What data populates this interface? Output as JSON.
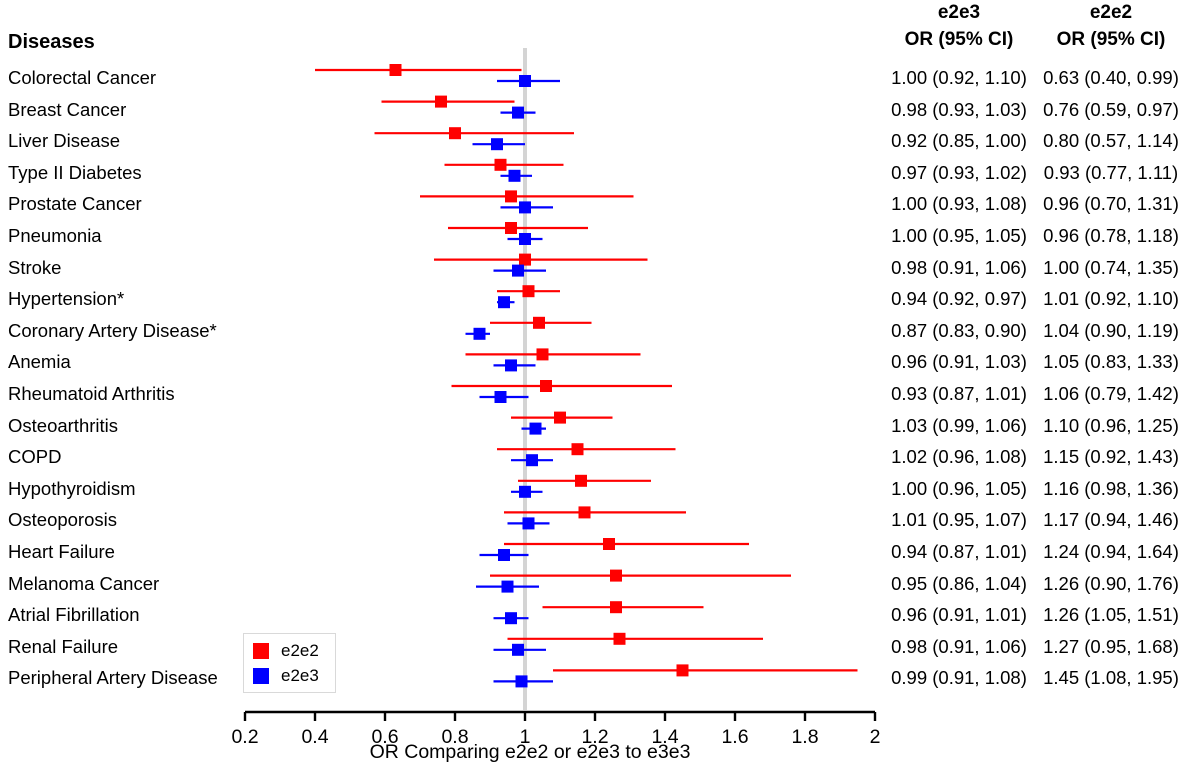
{
  "header": {
    "diseases_label": "Diseases",
    "col1_title": "e2e3",
    "col1_sub": "OR (95% CI)",
    "col2_title": "e2e2",
    "col2_sub": "OR (95% CI)"
  },
  "legend": {
    "items": [
      {
        "label": "e2e2",
        "color": "#FF0000",
        "name": "legend-e2e2"
      },
      {
        "label": "e2e3",
        "color": "#0000FF",
        "name": "legend-e2e3"
      }
    ]
  },
  "axis": {
    "title": "OR Comparing e2e2 or e2e3 to e3e3",
    "ticks": [
      "0.2",
      "0.4",
      "0.6",
      "0.8",
      "1",
      "1.2",
      "1.4",
      "1.6",
      "1.8",
      "2"
    ],
    "tick_values": [
      0.2,
      0.4,
      0.6,
      0.8,
      1.0,
      1.2,
      1.4,
      1.6,
      1.8,
      2.0
    ],
    "reference_line": 1.0
  },
  "chart_data": {
    "type": "forest",
    "title": "",
    "xlabel": "OR Comparing e2e2 or e2e3 to e3e3",
    "ylabel": "Diseases",
    "xlim": [
      0.2,
      2.0
    ],
    "grid": false,
    "reference_line": 1.0,
    "legend_position": "bottom-left",
    "series": [
      {
        "name": "e2e2",
        "color": "#FF0000"
      },
      {
        "name": "e2e3",
        "color": "#0000FF"
      }
    ],
    "categories": [
      "Colorectal Cancer",
      "Breast Cancer",
      "Liver Disease",
      "Type II Diabetes",
      "Prostate Cancer",
      "Pneumonia",
      "Stroke",
      "Hypertension*",
      "Coronary Artery Disease*",
      "Anemia",
      "Rheumatoid Arthritis",
      "Osteoarthritis",
      "COPD",
      "Hypothyroidism",
      "Osteoporosis",
      "Heart Failure",
      "Melanoma Cancer",
      "Atrial Fibrillation",
      "Renal Failure",
      "Peripheral Artery Disease"
    ],
    "rows": [
      {
        "disease": "Colorectal Cancer",
        "e2e3_text": "1.00 (0.92, 1.10)",
        "e2e2_text": "0.63 (0.40, 0.99)",
        "e2e3": {
          "or": 1.0,
          "lo": 0.92,
          "hi": 1.1
        },
        "e2e2": {
          "or": 0.63,
          "lo": 0.4,
          "hi": 0.99
        }
      },
      {
        "disease": "Breast Cancer",
        "e2e3_text": "0.98 (0.93, 1.03)",
        "e2e2_text": "0.76 (0.59, 0.97)",
        "e2e3": {
          "or": 0.98,
          "lo": 0.93,
          "hi": 1.03
        },
        "e2e2": {
          "or": 0.76,
          "lo": 0.59,
          "hi": 0.97
        }
      },
      {
        "disease": "Liver Disease",
        "e2e3_text": "0.92 (0.85, 1.00)",
        "e2e2_text": "0.80 (0.57, 1.14)",
        "e2e3": {
          "or": 0.92,
          "lo": 0.85,
          "hi": 1.0
        },
        "e2e2": {
          "or": 0.8,
          "lo": 0.57,
          "hi": 1.14
        }
      },
      {
        "disease": "Type II Diabetes",
        "e2e3_text": "0.97 (0.93, 1.02)",
        "e2e2_text": "0.93 (0.77, 1.11)",
        "e2e3": {
          "or": 0.97,
          "lo": 0.93,
          "hi": 1.02
        },
        "e2e2": {
          "or": 0.93,
          "lo": 0.77,
          "hi": 1.11
        }
      },
      {
        "disease": "Prostate Cancer",
        "e2e3_text": "1.00 (0.93, 1.08)",
        "e2e2_text": "0.96 (0.70, 1.31)",
        "e2e3": {
          "or": 1.0,
          "lo": 0.93,
          "hi": 1.08
        },
        "e2e2": {
          "or": 0.96,
          "lo": 0.7,
          "hi": 1.31
        }
      },
      {
        "disease": "Pneumonia",
        "e2e3_text": "1.00 (0.95, 1.05)",
        "e2e2_text": "0.96 (0.78, 1.18)",
        "e2e3": {
          "or": 1.0,
          "lo": 0.95,
          "hi": 1.05
        },
        "e2e2": {
          "or": 0.96,
          "lo": 0.78,
          "hi": 1.18
        }
      },
      {
        "disease": "Stroke",
        "e2e3_text": "0.98 (0.91, 1.06)",
        "e2e2_text": "1.00 (0.74, 1.35)",
        "e2e3": {
          "or": 0.98,
          "lo": 0.91,
          "hi": 1.06
        },
        "e2e2": {
          "or": 1.0,
          "lo": 0.74,
          "hi": 1.35
        }
      },
      {
        "disease": "Hypertension*",
        "e2e3_text": "0.94 (0.92, 0.97)",
        "e2e2_text": "1.01 (0.92, 1.10)",
        "e2e3": {
          "or": 0.94,
          "lo": 0.92,
          "hi": 0.97
        },
        "e2e2": {
          "or": 1.01,
          "lo": 0.92,
          "hi": 1.1
        }
      },
      {
        "disease": "Coronary Artery Disease*",
        "e2e3_text": "0.87 (0.83, 0.90)",
        "e2e2_text": "1.04 (0.90, 1.19)",
        "e2e3": {
          "or": 0.87,
          "lo": 0.83,
          "hi": 0.9
        },
        "e2e2": {
          "or": 1.04,
          "lo": 0.9,
          "hi": 1.19
        }
      },
      {
        "disease": "Anemia",
        "e2e3_text": "0.96 (0.91, 1.03)",
        "e2e2_text": "1.05 (0.83, 1.33)",
        "e2e3": {
          "or": 0.96,
          "lo": 0.91,
          "hi": 1.03
        },
        "e2e2": {
          "or": 1.05,
          "lo": 0.83,
          "hi": 1.33
        }
      },
      {
        "disease": "Rheumatoid Arthritis",
        "e2e3_text": "0.93 (0.87, 1.01)",
        "e2e2_text": "1.06 (0.79, 1.42)",
        "e2e3": {
          "or": 0.93,
          "lo": 0.87,
          "hi": 1.01
        },
        "e2e2": {
          "or": 1.06,
          "lo": 0.79,
          "hi": 1.42
        }
      },
      {
        "disease": "Osteoarthritis",
        "e2e3_text": "1.03 (0.99, 1.06)",
        "e2e2_text": "1.10 (0.96, 1.25)",
        "e2e3": {
          "or": 1.03,
          "lo": 0.99,
          "hi": 1.06
        },
        "e2e2": {
          "or": 1.1,
          "lo": 0.96,
          "hi": 1.25
        }
      },
      {
        "disease": "COPD",
        "e2e3_text": "1.02 (0.96, 1.08)",
        "e2e2_text": "1.15 (0.92, 1.43)",
        "e2e3": {
          "or": 1.02,
          "lo": 0.96,
          "hi": 1.08
        },
        "e2e2": {
          "or": 1.15,
          "lo": 0.92,
          "hi": 1.43
        }
      },
      {
        "disease": "Hypothyroidism",
        "e2e3_text": "1.00 (0.96, 1.05)",
        "e2e2_text": "1.16 (0.98, 1.36)",
        "e2e3": {
          "or": 1.0,
          "lo": 0.96,
          "hi": 1.05
        },
        "e2e2": {
          "or": 1.16,
          "lo": 0.98,
          "hi": 1.36
        }
      },
      {
        "disease": "Osteoporosis",
        "e2e3_text": "1.01 (0.95, 1.07)",
        "e2e2_text": "1.17 (0.94, 1.46)",
        "e2e3": {
          "or": 1.01,
          "lo": 0.95,
          "hi": 1.07
        },
        "e2e2": {
          "or": 1.17,
          "lo": 0.94,
          "hi": 1.46
        }
      },
      {
        "disease": "Heart Failure",
        "e2e3_text": "0.94 (0.87, 1.01)",
        "e2e2_text": "1.24 (0.94, 1.64)",
        "e2e3": {
          "or": 0.94,
          "lo": 0.87,
          "hi": 1.01
        },
        "e2e2": {
          "or": 1.24,
          "lo": 0.94,
          "hi": 1.64
        }
      },
      {
        "disease": "Melanoma Cancer",
        "e2e3_text": "0.95 (0.86, 1.04)",
        "e2e2_text": "1.26 (0.90, 1.76)",
        "e2e3": {
          "or": 0.95,
          "lo": 0.86,
          "hi": 1.04
        },
        "e2e2": {
          "or": 1.26,
          "lo": 0.9,
          "hi": 1.76
        }
      },
      {
        "disease": "Atrial Fibrillation",
        "e2e3_text": "0.96 (0.91, 1.01)",
        "e2e2_text": "1.26 (1.05, 1.51)",
        "e2e3": {
          "or": 0.96,
          "lo": 0.91,
          "hi": 1.01
        },
        "e2e2": {
          "or": 1.26,
          "lo": 1.05,
          "hi": 1.51
        }
      },
      {
        "disease": "Renal Failure",
        "e2e3_text": "0.98 (0.91, 1.06)",
        "e2e2_text": "1.27 (0.95, 1.68)",
        "e2e3": {
          "or": 0.98,
          "lo": 0.91,
          "hi": 1.06
        },
        "e2e2": {
          "or": 1.27,
          "lo": 0.95,
          "hi": 1.68
        }
      },
      {
        "disease": "Peripheral Artery Disease",
        "e2e3_text": "0.99 (0.91, 1.08)",
        "e2e2_text": "1.45 (1.08, 1.95)",
        "e2e3": {
          "or": 0.99,
          "lo": 0.91,
          "hi": 1.08
        },
        "e2e2": {
          "or": 1.45,
          "lo": 1.08,
          "hi": 1.95
        }
      }
    ]
  }
}
